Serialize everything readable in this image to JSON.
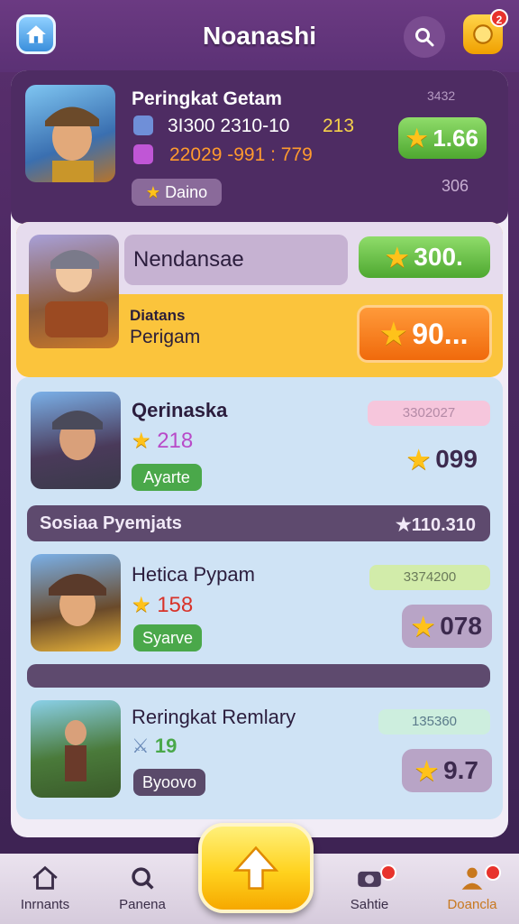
{
  "header": {
    "title": "Noanashi",
    "home_icon": "home-icon",
    "search_icon": "search-icon",
    "notification_icon": "notification-icon",
    "notification_count": "2"
  },
  "player": {
    "name": "Peringkat Getam",
    "stat1": "3I300 2310-10",
    "stat1_extra": "213",
    "stat2": "22029 -991 : 779",
    "badge_label": "Daino",
    "score": "1.66",
    "corner_top": "3432",
    "corner_bottom": "306"
  },
  "highlight": {
    "name": "Nendansae",
    "score": "300.",
    "sub1": "Diatans",
    "sub2": "Perigam",
    "cta_score": "90..."
  },
  "list": [
    {
      "name": "Qerinaska",
      "star_value": "218",
      "tag": "Ayarte",
      "top_pill": "3302027",
      "score": "099"
    },
    {
      "name": "Hetica Pypam",
      "star_value": "158",
      "tag": "Syarve",
      "top_pill": "3374200",
      "score": "078"
    },
    {
      "name": "Reringkat Remlary",
      "star_value": "19",
      "tag": "Byoovo",
      "top_pill": "135360",
      "score": "9.7"
    }
  ],
  "section": {
    "label": "Sosiaa Pyemjats",
    "value": "★110.310"
  },
  "nav": {
    "items": [
      {
        "label": "Inrnants",
        "icon": "home-outline-icon"
      },
      {
        "label": "Panena",
        "icon": "search-outline-icon"
      },
      {
        "label": "Sahtie",
        "icon": "camera-icon"
      },
      {
        "label": "Doancla",
        "icon": "user-icon"
      }
    ],
    "center_icon": "up-arrow-icon"
  },
  "colors": {
    "accent_green": "#5cb83a",
    "accent_orange": "#f47a12",
    "highlight_yellow": "#fbc43c",
    "list_blue": "#cfe3f5",
    "header_purple": "#5b3175"
  }
}
